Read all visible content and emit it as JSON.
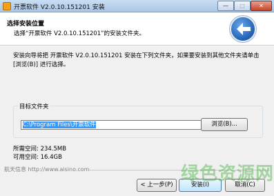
{
  "window": {
    "title": "开票软件 V2.0.10.151201 安装",
    "controls": {
      "minimize": "—",
      "maximize": "□",
      "close": "✕"
    }
  },
  "header": {
    "title": "选择安装位置",
    "subtitle": "选择“开票软件 V2.0.10.151201”的安装文件夹。",
    "icon": "back-arrow-globe-icon"
  },
  "body": {
    "description": "安装向导将把 开票软件 V2.0.10.151201 安装在下列文件夹，如果要安装到其他文件夹请单击 [浏览(B)] 进行选择。",
    "target_folder_label": "目标文件夹",
    "target_folder_value": "C:\\Program Files\\开票软件",
    "browse_label": "浏览(B)...",
    "space_required": "所需空间: 234.5MB",
    "space_available": "可用空间: 16.4GB"
  },
  "footer": {
    "brand": "航天信息 http://www.aisino.com",
    "back_label": "< 上一步(P)",
    "install_label": "安装(I)",
    "cancel_label": "取消(C)"
  },
  "watermark": "绿色资源网",
  "colors": {
    "titlebar": "#b9d3ee",
    "selection": "#3399ff",
    "watermark": "#47b240"
  }
}
